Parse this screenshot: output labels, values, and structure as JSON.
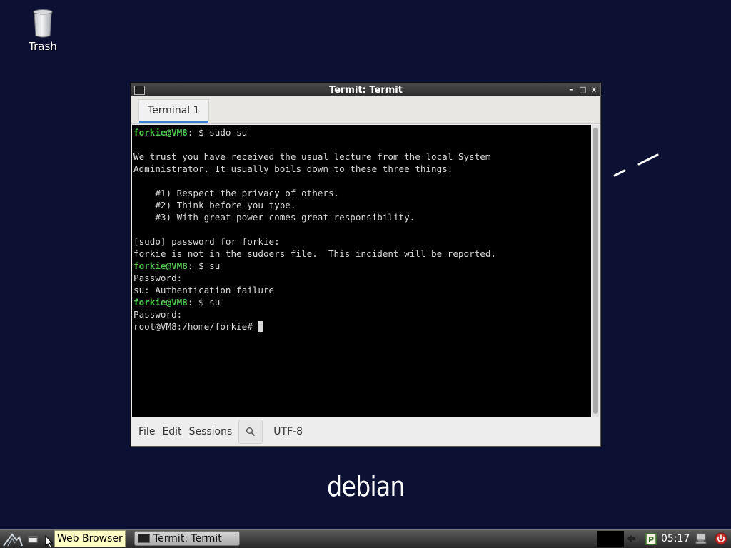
{
  "desktop": {
    "trash_label": "Trash",
    "logo_text": "debian"
  },
  "window": {
    "title": "Termit: Termit",
    "controls": {
      "minimize": "–",
      "maximize": "□",
      "close": "×"
    },
    "tab_label": "Terminal 1",
    "terminal_lines": [
      {
        "prompt": "forkie@VM8",
        "rest": ": $ sudo su"
      },
      {
        "text": ""
      },
      {
        "text": "We trust you have received the usual lecture from the local System"
      },
      {
        "text": "Administrator. It usually boils down to these three things:"
      },
      {
        "text": ""
      },
      {
        "text": "    #1) Respect the privacy of others."
      },
      {
        "text": "    #2) Think before you type."
      },
      {
        "text": "    #3) With great power comes great responsibility."
      },
      {
        "text": ""
      },
      {
        "text": "[sudo] password for forkie:"
      },
      {
        "text": "forkie is not in the sudoers file.  This incident will be reported."
      },
      {
        "prompt": "forkie@VM8",
        "rest": ": $ su"
      },
      {
        "text": "Password:"
      },
      {
        "text": "su: Authentication failure"
      },
      {
        "prompt": "forkie@VM8",
        "rest": ": $ su"
      },
      {
        "text": "Password:"
      },
      {
        "text": "root@VM8:/home/forkie# ",
        "cursor": true
      }
    ],
    "menu": {
      "file": "File",
      "edit": "Edit",
      "sessions": "Sessions",
      "encoding": "UTF-8"
    }
  },
  "taskbar": {
    "tooltip": "Web Browser",
    "task_button_label": "Termit: Termit",
    "clock": "05:17"
  },
  "colors": {
    "desktop_bg": "#0c1134",
    "prompt": "#4ec94e",
    "tab_accent": "#3d7fd4",
    "tooltip_bg": "#ffffc6"
  }
}
